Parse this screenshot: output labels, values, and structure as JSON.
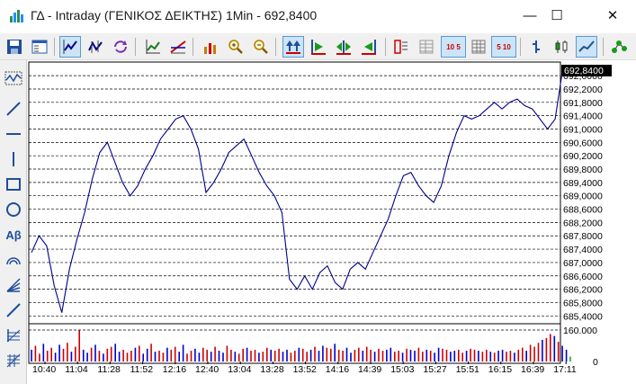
{
  "window": {
    "title": "ΓΔ - Intraday (ΓΕΝΙΚΟΣ ΔΕΙΚΤΗΣ) 1Min - 692,8400",
    "minimize_glyph": "—",
    "maximize_glyph": "☐",
    "close_glyph": "✕"
  },
  "toolbar": {
    "icons": [
      "save-icon",
      "properties-icon",
      "line-chart-icon",
      "candlestick-chart-icon",
      "refresh-icon",
      "indicator-icon",
      "trendline-icon",
      "volume-icon",
      "zoom-in-icon",
      "zoom-out-icon",
      "scroll-both-icon",
      "scroll-right-icon",
      "scroll-center-icon",
      "scroll-left-icon",
      "decimals-icon",
      "grid-icon",
      "quote-5-10-icon",
      "grid-2-icon",
      "quote-510-icon",
      "bar-chart-icon",
      "candle-chart-icon",
      "line-chart-mode-icon",
      "network-icon"
    ],
    "quote_label_1": "10 5",
    "quote_label_2": "5 10"
  },
  "left_tools": [
    "curve-tool-icon",
    "line-tool-icon",
    "horizontal-line-icon",
    "vertical-line-icon",
    "rectangle-tool-icon",
    "ellipse-tool-icon",
    "text-tool-icon",
    "arc-tool-icon",
    "fan-tool-icon",
    "channel-tool-icon",
    "fib-tool-icon",
    "grid-tool-icon"
  ],
  "left_text_tool_label": "Aβ",
  "colors": {
    "price_line": "#00008b",
    "vol_up": "#0000cc",
    "vol_down": "#cc0000",
    "vol_last": "#22aa22",
    "current_price_bg": "#000000",
    "active_button_bg": "#cce4f7"
  },
  "chart_data": {
    "type": "line",
    "current_price_label": "692,8400",
    "y_tick_labels": [
      "692,6000",
      "692,2000",
      "691,8000",
      "691,4000",
      "691,0000",
      "690,6000",
      "690,2000",
      "689,8000",
      "689,4000",
      "689,0000",
      "688,6000",
      "688,2000",
      "687,8000",
      "687,4000",
      "687,0000",
      "686,6000",
      "686,2000",
      "685,8000",
      "685,4000"
    ],
    "y_ticks": [
      692.6,
      692.2,
      691.8,
      691.4,
      691.0,
      690.6,
      690.2,
      689.8,
      689.4,
      689.0,
      688.6,
      688.2,
      687.8,
      687.4,
      687.0,
      686.6,
      686.2,
      685.8,
      685.4
    ],
    "ylim": [
      685.3,
      692.9
    ],
    "x_tick_labels": [
      "10:40",
      "11:04",
      "11:28",
      "11:52",
      "12:16",
      "12:40",
      "13:04",
      "13:28",
      "13:52",
      "14:16",
      "14:39",
      "15:03",
      "15:27",
      "15:51",
      "16:15",
      "16:39",
      "17:11"
    ],
    "series": [
      {
        "values": [
          687.3,
          687.8,
          687.5,
          686.3,
          685.5,
          686.8,
          687.7,
          688.5,
          689.5,
          690.3,
          690.6,
          690.0,
          689.4,
          689.0,
          689.3,
          689.8,
          690.2,
          690.7,
          691.0,
          691.3,
          691.4,
          691.0,
          690.4,
          689.1,
          689.4,
          689.8,
          690.3,
          690.5,
          690.7,
          690.2,
          689.7,
          689.3,
          689.0,
          688.5,
          686.5,
          686.2,
          686.6,
          686.2,
          686.7,
          686.9,
          686.4,
          686.2,
          686.8,
          687.0,
          686.8,
          687.3,
          687.8,
          688.3,
          689.0,
          689.6,
          689.7,
          689.3,
          689.0,
          688.8,
          689.3,
          690.2,
          690.9,
          691.4,
          691.3,
          691.4,
          691.6,
          691.8,
          691.6,
          691.8,
          691.9,
          691.7,
          691.6,
          691.3,
          691.0,
          691.3,
          692.8,
          692.8
        ]
      }
    ],
    "volume": {
      "y_tick_labels": [
        "160.000",
        "0"
      ],
      "max": 160000,
      "values": [
        60,
        80,
        40,
        90,
        55,
        70,
        45,
        85,
        65,
        95,
        50,
        75,
        160,
        60,
        45,
        70,
        85,
        55,
        40,
        65,
        75,
        90,
        50,
        60,
        45,
        55,
        70,
        80,
        40,
        65,
        90,
        50,
        55,
        45,
        70,
        60,
        75,
        50,
        85,
        40,
        55,
        65,
        45,
        70,
        60,
        50,
        75,
        55,
        45,
        80,
        60,
        50,
        40,
        65,
        70,
        55,
        60,
        45,
        50,
        70,
        60,
        55,
        65,
        50,
        60,
        45,
        55,
        70,
        65,
        50,
        60,
        75,
        55,
        80,
        70,
        65,
        90,
        60,
        55,
        70,
        45,
        60,
        70,
        55,
        75,
        60,
        50,
        65,
        55,
        60,
        70,
        50,
        55,
        45,
        65,
        60,
        55,
        70,
        50,
        60,
        55,
        45,
        70,
        65,
        60,
        50,
        55,
        60,
        45,
        55,
        65,
        60,
        55,
        50,
        60,
        50,
        45,
        55,
        60,
        50,
        55,
        45,
        60,
        70,
        55,
        85,
        75,
        95,
        110,
        120,
        140,
        130,
        100,
        80,
        60,
        25
      ],
      "directions": "uddudduuddudduudududduuddduduududdudduudduudduduudduddudduddudduuddudduduuddudduudduddudduudduduudduduudduudduddudduduudduddudddudduduuudddu"
    }
  }
}
